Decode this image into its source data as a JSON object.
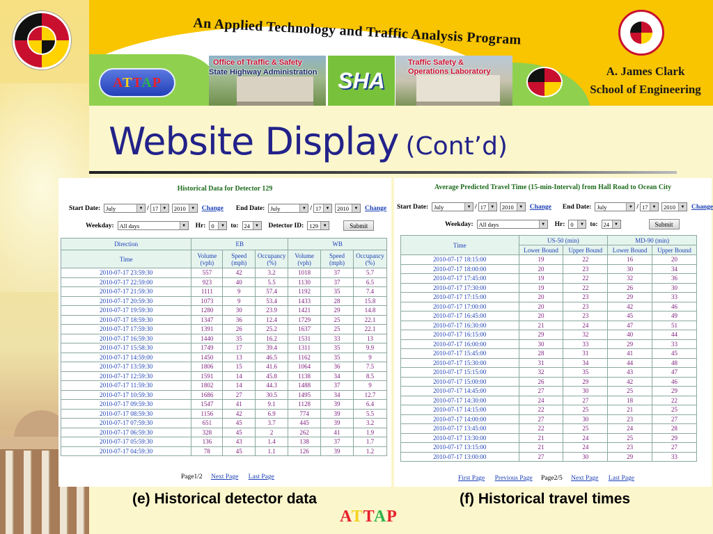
{
  "header": {
    "program_title": "An Applied Technology and Traffic Analysis Program",
    "attap_logo": [
      "A",
      "T",
      "T",
      "A",
      "P"
    ],
    "attap_colors": [
      "#e8202a",
      "#f5d21a",
      "#e8202a",
      "#2fb44a",
      "#e8202a"
    ],
    "office_caption": [
      "Office of Traffic & Safety",
      "State Highway Administration"
    ],
    "sha_logo": "SHA",
    "lab_caption": [
      "Traffic Safety &",
      "Operations Laboratory"
    ],
    "school": [
      "A. James Clark",
      "School of Engineering"
    ]
  },
  "slide": {
    "title": "Website Display",
    "subtitle": "(Cont’d)"
  },
  "left_panel": {
    "title": "Historical Data for Detector 129",
    "start_date_label": "Start Date:",
    "start_month": "July",
    "start_day": "17",
    "start_year": "2010",
    "change_label": "Change",
    "end_date_label": "End Date:",
    "end_month": "July",
    "end_day": "17",
    "end_year": "2010",
    "weekday_label": "Weekday:",
    "weekday_value": "All days",
    "hr_label": "Hr:",
    "hr_from": "0",
    "to_label": "to:",
    "hr_to": "24",
    "detector_label": "Detector ID:",
    "detector_value": "129",
    "submit_label": "Submit",
    "table": {
      "direction_header": "Direction",
      "time_header": "Time",
      "eb_header": "EB",
      "wb_header": "WB",
      "col_volume": "Volume (vph)",
      "col_speed": "Speed (mph)",
      "col_occupancy": "Occupancy (%)",
      "rows": [
        [
          "2010-07-17 23:59:30",
          "557",
          "42",
          "3.2",
          "1018",
          "37",
          "5.7"
        ],
        [
          "2010-07-17 22:59:00",
          "923",
          "40",
          "5.5",
          "1130",
          "37",
          "6.5"
        ],
        [
          "2010-07-17 21:59:30",
          "1111",
          "9",
          "57.4",
          "1192",
          "35",
          "7.4"
        ],
        [
          "2010-07-17 20:59:30",
          "1073",
          "9",
          "53.4",
          "1433",
          "28",
          "15.8"
        ],
        [
          "2010-07-17 19:59:30",
          "1280",
          "30",
          "23.9",
          "1421",
          "29",
          "14.8"
        ],
        [
          "2010-07-17 18:59:30",
          "1347",
          "36",
          "12.4",
          "1729",
          "25",
          "22.1"
        ],
        [
          "2010-07-17 17:59:30",
          "1391",
          "26",
          "25.2",
          "1637",
          "25",
          "22.1"
        ],
        [
          "2010-07-17 16:59:30",
          "1440",
          "35",
          "16.2",
          "1531",
          "33",
          "13"
        ],
        [
          "2010-07-17 15:58:30",
          "1749",
          "17",
          "39.4",
          "1311",
          "35",
          "9.9"
        ],
        [
          "2010-07-17 14:59:00",
          "1450",
          "13",
          "46.5",
          "1162",
          "35",
          "9"
        ],
        [
          "2010-07-17 13:59:30",
          "1806",
          "15",
          "41.6",
          "1064",
          "36",
          "7.5"
        ],
        [
          "2010-07-17 12:59:30",
          "1591",
          "14",
          "45.8",
          "1138",
          "34",
          "8.5"
        ],
        [
          "2010-07-17 11:59:30",
          "1802",
          "14",
          "44.3",
          "1488",
          "37",
          "9"
        ],
        [
          "2010-07-17 10:59:30",
          "1686",
          "27",
          "30.5",
          "1495",
          "34",
          "12.7"
        ],
        [
          "2010-07-17 09:59:30",
          "1547",
          "41",
          "9.1",
          "1128",
          "39",
          "6.4"
        ],
        [
          "2010-07-17 08:59:30",
          "1156",
          "42",
          "6.9",
          "774",
          "39",
          "5.5"
        ],
        [
          "2010-07-17 07:59:30",
          "651",
          "45",
          "3.7",
          "445",
          "39",
          "3.2"
        ],
        [
          "2010-07-17 06:59:30",
          "328",
          "45",
          "2",
          "262",
          "41",
          "1.9"
        ],
        [
          "2010-07-17 05:59:30",
          "136",
          "43",
          "1.4",
          "138",
          "37",
          "1.7"
        ],
        [
          "2010-07-17 04:59:30",
          "78",
          "45",
          "1.1",
          "126",
          "39",
          "1.2"
        ]
      ]
    },
    "pager": {
      "page_text": "Page1/2",
      "next_label": "Next Page",
      "last_label": "Last Page"
    }
  },
  "right_panel": {
    "title": "Average Predicted Travel Time (15-min-Interval) from Hall Road to Ocean City",
    "start_date_label": "Start Date:",
    "start_month": "July",
    "start_day": "17",
    "start_year": "2010",
    "change_label": "Change",
    "end_date_label": "End Date:",
    "end_month": "July",
    "end_day": "17",
    "end_year": "2010",
    "weekday_label": "Weekday:",
    "weekday_value": "All days",
    "hr_label": "Hr:",
    "hr_from": "0",
    "to_label": "to:",
    "hr_to": "24",
    "submit_label": "Submit",
    "table": {
      "time_header": "Time",
      "us50_header": "US-50 (min)",
      "md90_header": "MD-90 (min)",
      "col_lower": "Lower Bound",
      "col_upper": "Upper Bound",
      "rows": [
        [
          "2010-07-17 18:15:00",
          "19",
          "22",
          "16",
          "20"
        ],
        [
          "2010-07-17 18:00:00",
          "20",
          "23",
          "30",
          "34"
        ],
        [
          "2010-07-17 17:45:00",
          "19",
          "22",
          "32",
          "36"
        ],
        [
          "2010-07-17 17:30:00",
          "19",
          "22",
          "26",
          "30"
        ],
        [
          "2010-07-17 17:15:00",
          "20",
          "23",
          "29",
          "33"
        ],
        [
          "2010-07-17 17:00:00",
          "20",
          "23",
          "42",
          "46"
        ],
        [
          "2010-07-17 16:45:00",
          "20",
          "23",
          "45",
          "49"
        ],
        [
          "2010-07-17 16:30:00",
          "21",
          "24",
          "47",
          "51"
        ],
        [
          "2010-07-17 16:15:00",
          "29",
          "32",
          "40",
          "44"
        ],
        [
          "2010-07-17 16:00:00",
          "30",
          "33",
          "29",
          "33"
        ],
        [
          "2010-07-17 15:45:00",
          "28",
          "31",
          "41",
          "45"
        ],
        [
          "2010-07-17 15:30:00",
          "31",
          "34",
          "44",
          "48"
        ],
        [
          "2010-07-17 15:15:00",
          "32",
          "35",
          "43",
          "47"
        ],
        [
          "2010-07-17 15:00:00",
          "26",
          "29",
          "42",
          "46"
        ],
        [
          "2010-07-17 14:45:00",
          "27",
          "30",
          "25",
          "29"
        ],
        [
          "2010-07-17 14:30:00",
          "24",
          "27",
          "18",
          "22"
        ],
        [
          "2010-07-17 14:15:00",
          "22",
          "25",
          "21",
          "25"
        ],
        [
          "2010-07-17 14:00:00",
          "27",
          "30",
          "23",
          "27"
        ],
        [
          "2010-07-17 13:45:00",
          "22",
          "25",
          "24",
          "28"
        ],
        [
          "2010-07-17 13:30:00",
          "21",
          "24",
          "25",
          "29"
        ],
        [
          "2010-07-17 13:15:00",
          "21",
          "24",
          "23",
          "27"
        ],
        [
          "2010-07-17 13:00:00",
          "27",
          "30",
          "29",
          "33"
        ]
      ]
    },
    "pager": {
      "first_label": "First Page",
      "prev_label": "Previous Page",
      "page_text": "Page2/5",
      "next_label": "Next Page",
      "last_label": "Last Page"
    }
  },
  "captions": {
    "left": "(e) Historical detector data",
    "right": "(f) Historical travel times"
  },
  "colors": {
    "title_blue": "#22228a",
    "banner_yellow": "#f9c400",
    "table_link_blue": "#1a3fb5",
    "value_purple": "#7a1a7a",
    "panel_title_green": "#1e6b1e"
  }
}
